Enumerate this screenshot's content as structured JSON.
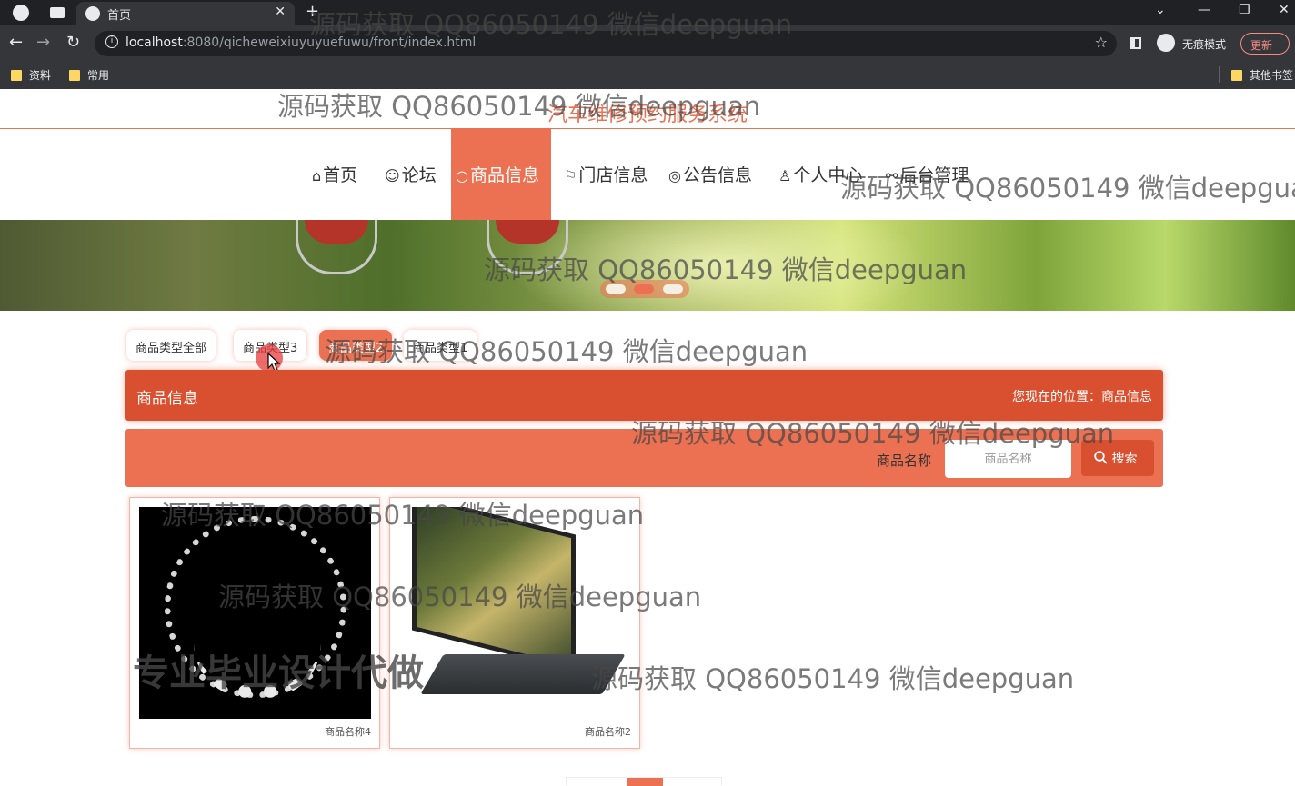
{
  "browser": {
    "tab_title": "首页",
    "new_tab": "+",
    "url_host": "localhost",
    "url_rest": ":8080/qicheweixiuyuyuefuwu/front/index.html",
    "incognito_label": "无痕模式",
    "update_label": "更新",
    "bookmarks": [
      "资料",
      "常用"
    ],
    "other_bookmarks": "其他书签"
  },
  "site": {
    "title": "汽车维修预约服务系统",
    "nav": [
      {
        "icon": "⌂",
        "label": "首页"
      },
      {
        "icon": "☺",
        "label": "论坛"
      },
      {
        "icon": "○",
        "label": "商品信息"
      },
      {
        "icon": "⚐",
        "label": "门店信息"
      },
      {
        "icon": "◎",
        "label": "公告信息"
      },
      {
        "icon": "♙",
        "label": "个人中心"
      },
      {
        "icon": "⚯",
        "label": "后台管理"
      }
    ]
  },
  "categories": [
    "商品类型全部",
    "商品类型3",
    "商品类型2",
    "商品类型1"
  ],
  "breadcrumb": {
    "heading": "商品信息",
    "location": "您现在的位置：商品信息"
  },
  "search": {
    "label": "商品名称",
    "placeholder": "商品名称",
    "button": "搜索"
  },
  "products": [
    {
      "name": "商品名称4",
      "image": "necklace"
    },
    {
      "name": "商品名称2",
      "image": "laptop"
    }
  ],
  "carousel": {
    "active_index": 1,
    "count": 3
  },
  "watermarks": {
    "text": "源码获取 QQ86050149 微信deepguan",
    "big_text": "专业毕业设计代做"
  },
  "colors": {
    "accent": "#ec7152",
    "accent_dark": "#d8502f"
  }
}
